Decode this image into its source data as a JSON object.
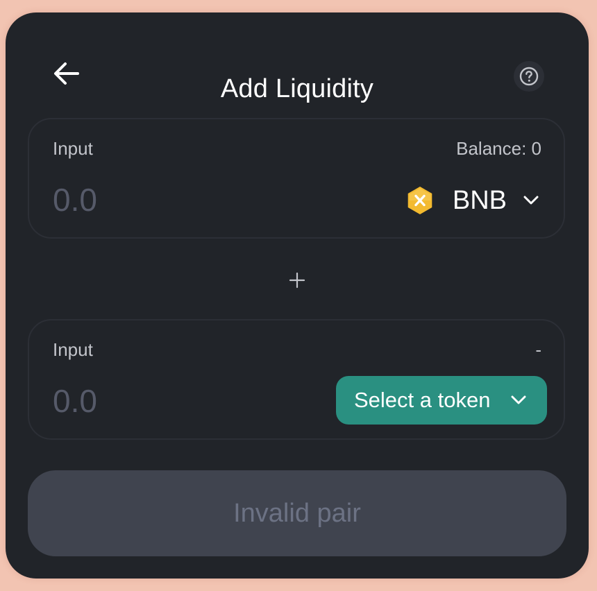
{
  "header": {
    "title": "Add Liquidity",
    "back_icon": "arrow-left-icon",
    "help_icon": "question-circle-icon"
  },
  "panels": [
    {
      "label": "Input",
      "right_label": "Balance: 0",
      "amount_value": "",
      "amount_placeholder": "0.0",
      "token": {
        "symbol": "BNB",
        "icon": "bnb-token-icon",
        "icon_color": "#f3ba2f"
      }
    },
    {
      "label": "Input",
      "right_label": "-",
      "amount_value": "",
      "amount_placeholder": "0.0",
      "select_label": "Select a token"
    }
  ],
  "separator_icon": "plus-icon",
  "submit": {
    "label": "Invalid pair",
    "disabled": true
  },
  "colors": {
    "page_background": "#f2c4b2",
    "card_background": "#212429",
    "accent": "#2a9081",
    "disabled_button": "#40444f",
    "disabled_text": "#6c7284",
    "placeholder": "#565a69"
  }
}
